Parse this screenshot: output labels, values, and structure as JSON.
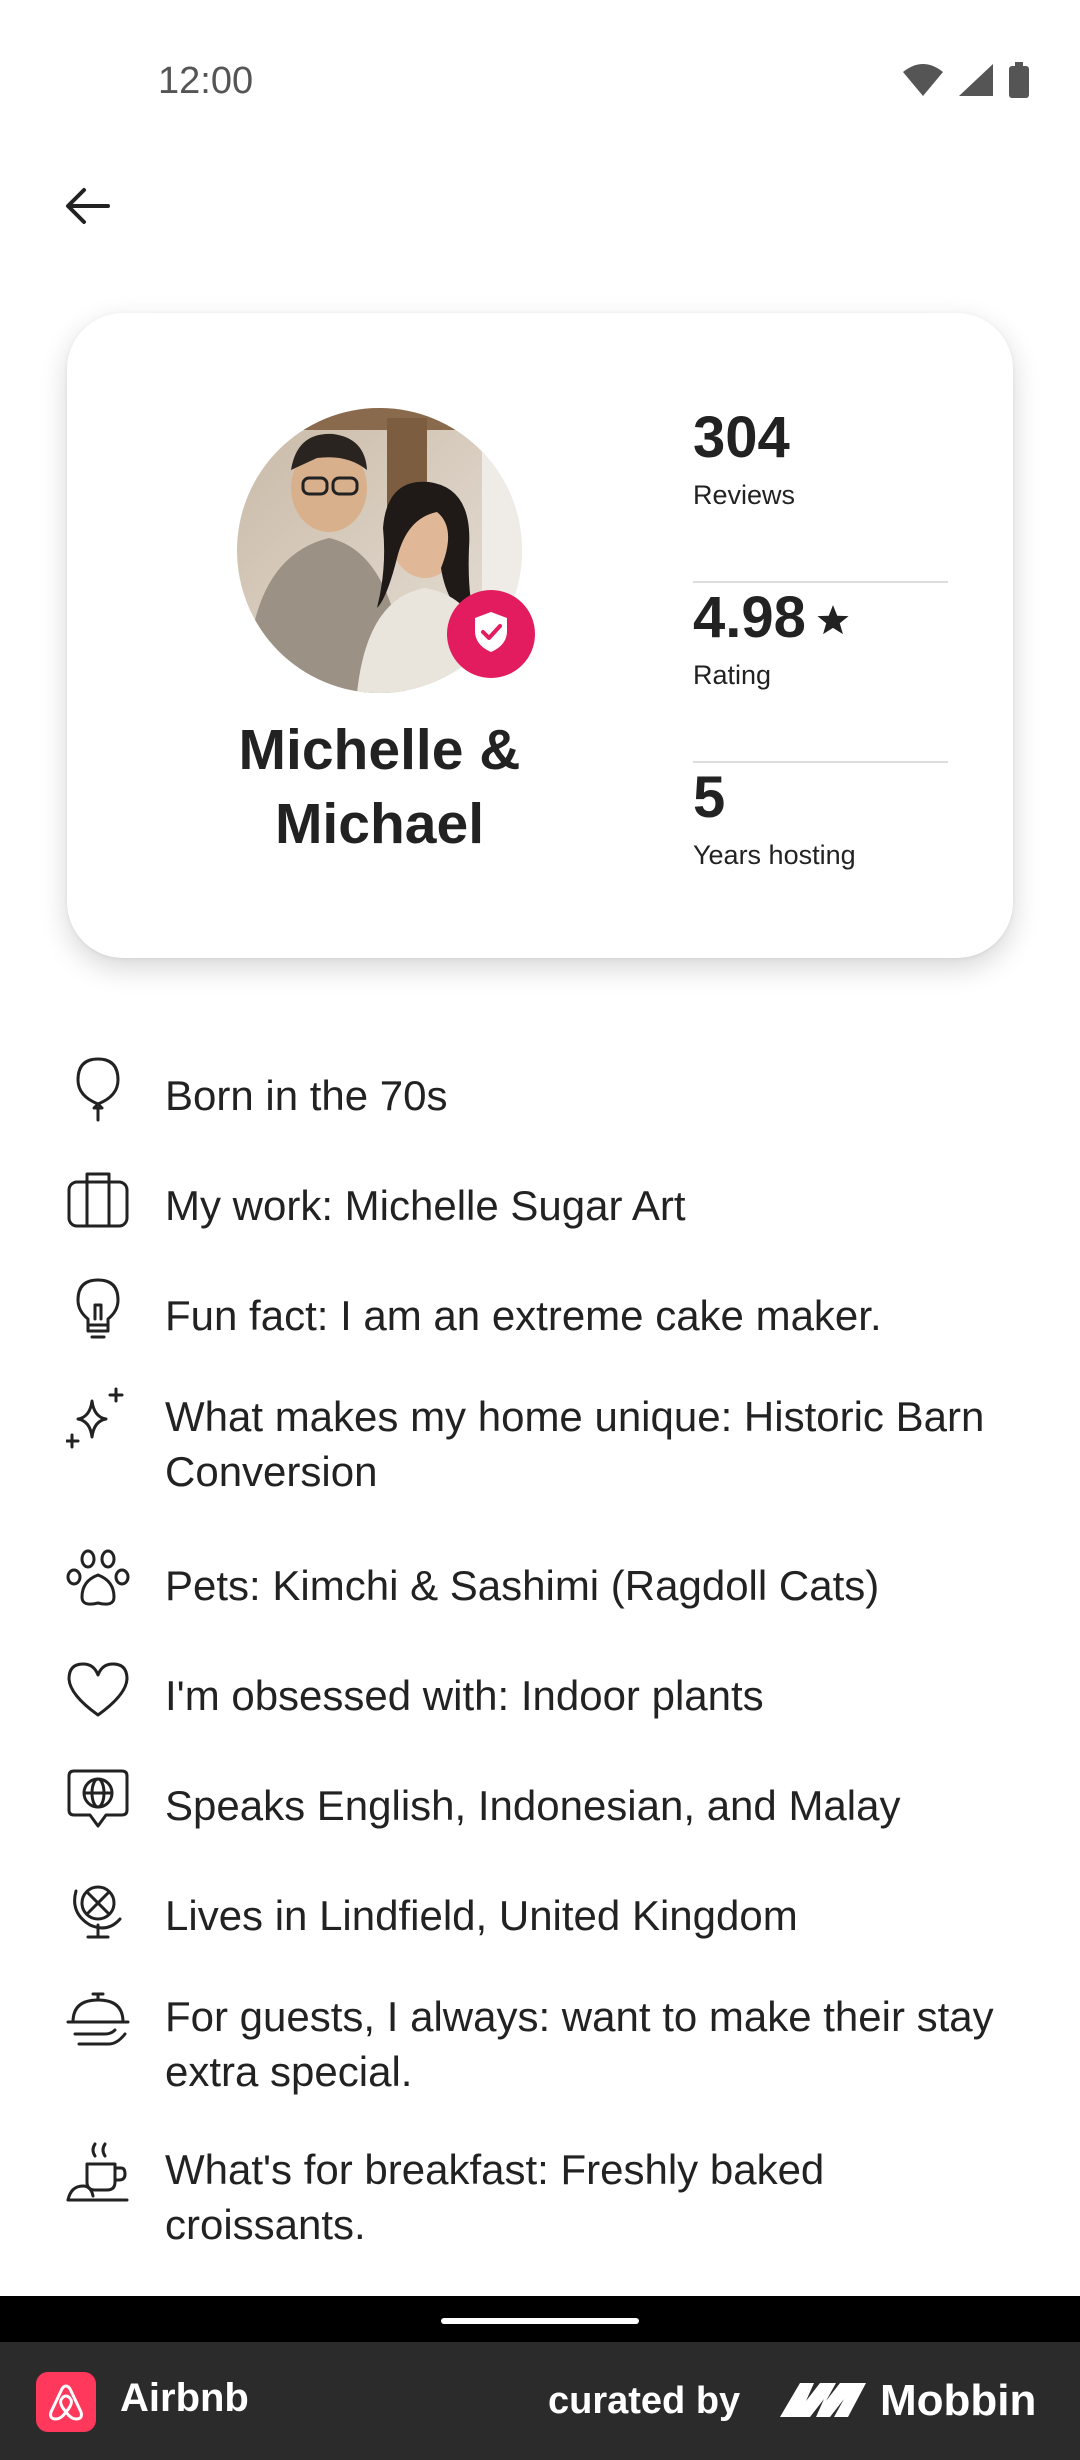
{
  "status_bar": {
    "time": "12:00",
    "icons": [
      "wifi-icon",
      "signal-icon",
      "battery-icon"
    ]
  },
  "header": {
    "back_icon": "arrow-left-icon"
  },
  "host_card": {
    "name": "Michelle & Michael",
    "verified_icon": "shield-check-icon",
    "stats": [
      {
        "value": "304",
        "label": "Reviews"
      },
      {
        "value": "4.98",
        "label": "Rating",
        "icon": "star-icon"
      },
      {
        "value": "5",
        "label": "Years hosting"
      }
    ]
  },
  "details": [
    {
      "icon": "balloon-icon",
      "text": "Born in the 70s"
    },
    {
      "icon": "briefcase-icon",
      "text": "My work: Michelle Sugar Art"
    },
    {
      "icon": "lightbulb-icon",
      "text": "Fun fact: I am an extreme cake maker."
    },
    {
      "icon": "sparkles-icon",
      "text": "What makes my home unique: Historic Barn Conversion"
    },
    {
      "icon": "paw-icon",
      "text": "Pets: Kimchi & Sashimi (Ragdoll Cats)"
    },
    {
      "icon": "heart-icon",
      "text": "I'm obsessed with: Indoor plants"
    },
    {
      "icon": "speech-globe-icon",
      "text": "Speaks English, Indonesian, and Malay"
    },
    {
      "icon": "globe-stand-icon",
      "text": "Lives in Lindfield, United Kingdom"
    },
    {
      "icon": "cloche-icon",
      "text": "For guests, I always: want to make their stay extra special."
    },
    {
      "icon": "coffee-icon",
      "text": "What's for breakfast: Freshly baked croissants."
    }
  ],
  "footer": {
    "app_name": "Airbnb",
    "curated_by": "curated by",
    "brand": "Mobbin"
  },
  "colors": {
    "accent": "#e31c5f",
    "airbnb": "#ff385c",
    "text": "#222222",
    "footer_bg": "#2b2b2b"
  }
}
